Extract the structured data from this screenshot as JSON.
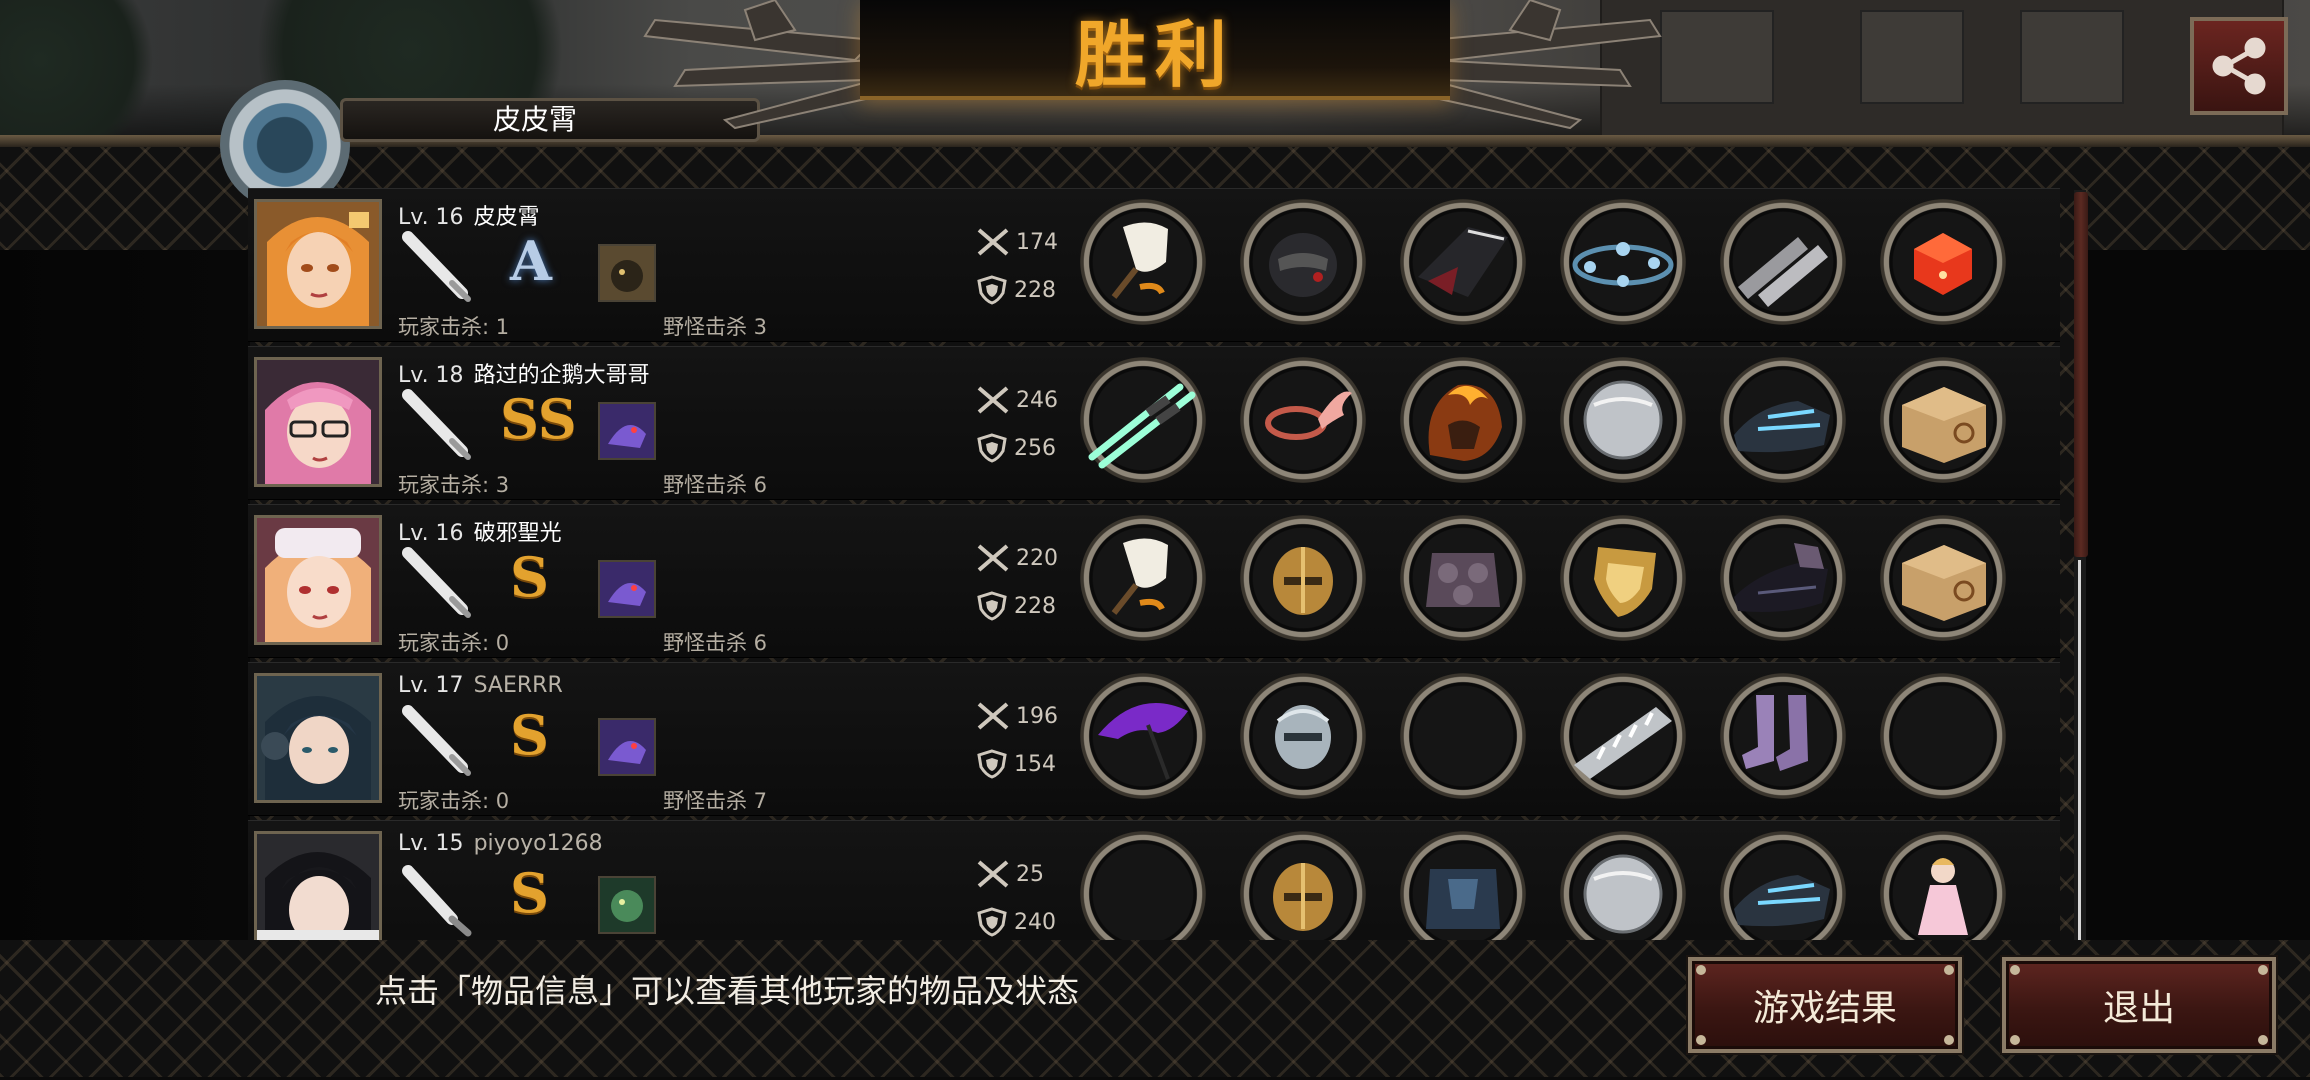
{
  "header": {
    "title": "胜利",
    "partial_name": "皮皮霄"
  },
  "players": [
    {
      "level": "Lv. 16",
      "name": "皮皮霄",
      "grade": "A",
      "player_kills": "玩家击杀: 1",
      "monster_kills": "野怪击杀 3",
      "attack": "174",
      "defense": "228",
      "items": [
        "bone-fan",
        "black-helmet",
        "dark-armor",
        "crystal-belt",
        "chain-gauntlets",
        "red-dice"
      ]
    },
    {
      "level": "Lv. 18",
      "name": "路过的企鹅大哥哥",
      "grade": "SS",
      "player_kills": "玩家击杀: 3",
      "monster_kills": "野怪击杀 6",
      "attack": "246",
      "defense": "256",
      "items": [
        "twin-lightsabers",
        "winged-circlet",
        "flame-armor",
        "steel-disc",
        "cyber-boots",
        "cat-box"
      ]
    },
    {
      "level": "Lv. 16",
      "name": "破邪聖光",
      "grade": "S",
      "player_kills": "玩家击杀: 0",
      "monster_kills": "野怪击杀 6",
      "attack": "220",
      "defense": "228",
      "items": [
        "bone-fan",
        "golden-helmet",
        "stone-armor",
        "golden-shield",
        "dark-boots",
        "cat-box"
      ]
    },
    {
      "level": "Lv. 17",
      "name": "SAERRR",
      "grade": "S",
      "player_kills": "玩家击杀: 0",
      "monster_kills": "野怪击杀 7",
      "attack": "196",
      "defense": "154",
      "items": [
        "purple-umbrella",
        "silver-helmet",
        "empty",
        "spiked-bracer",
        "purple-boots",
        "empty"
      ]
    },
    {
      "level": "Lv. 15",
      "name": "piyoyo1268",
      "grade": "S",
      "player_kills": "",
      "monster_kills": "",
      "attack": "25",
      "defense": "240",
      "items": [
        "empty",
        "golden-helmet",
        "blue-armor",
        "steel-disc",
        "cyber-boots",
        "doll"
      ]
    }
  ],
  "footer": {
    "hint": "点击「物品信息」可以查看其他玩家的物品及状态",
    "result_button": "游戏结果",
    "exit_button": "退出"
  },
  "colors": {
    "title": "#f0a72a",
    "button": "#4a1c17",
    "grade_gold": "#e3a22e",
    "grade_silver": "#b7cce6"
  }
}
